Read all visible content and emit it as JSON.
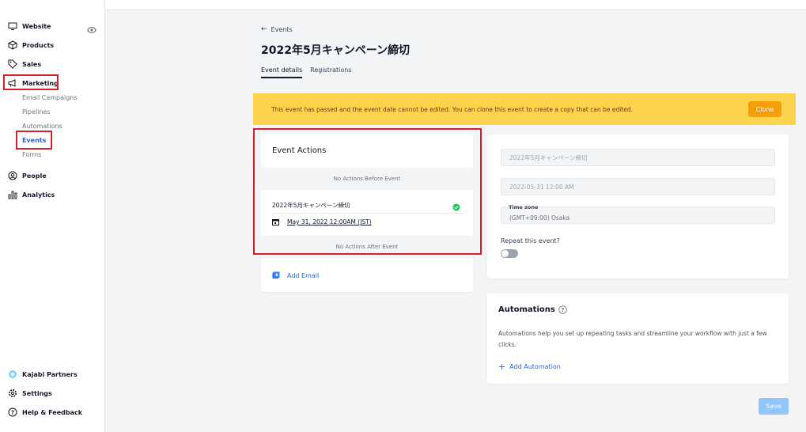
{
  "sidebar": {
    "items": [
      {
        "label": "Website",
        "icon": "monitor-icon"
      },
      {
        "label": "Products",
        "icon": "box-icon"
      },
      {
        "label": "Sales",
        "icon": "tag-icon"
      },
      {
        "label": "Marketing",
        "icon": "megaphone-icon"
      },
      {
        "label": "People",
        "icon": "person-icon"
      },
      {
        "label": "Analytics",
        "icon": "bar-chart-icon"
      }
    ],
    "marketing_sub": [
      "Email Campaigns",
      "Pipelines",
      "Automations",
      "Events",
      "Forms"
    ],
    "bottom": [
      {
        "label": "Kajabi Partners",
        "icon": "partners-icon"
      },
      {
        "label": "Settings",
        "icon": "gear-icon"
      },
      {
        "label": "Help & Feedback",
        "icon": "help-icon"
      }
    ]
  },
  "header": {
    "back_label": "Events",
    "title": "2022年5月キャンペーン締切",
    "tabs": [
      "Event details",
      "Registrations"
    ]
  },
  "banner": {
    "text": "This event has passed and the event date cannot be edited. You can clone this event to create a copy that can be edited.",
    "clone_label": "Clone"
  },
  "event_actions": {
    "title": "Event Actions",
    "before_label": "No Actions Before Event",
    "event_name": "2022年5月キャンペーン締切",
    "event_date": "May 31, 2022 12:00AM (JST)",
    "after_label": "No Actions After Event",
    "add_email_label": "Add Email"
  },
  "details": {
    "name_value": "2022年5月キャンペーン締切",
    "date_value": "2022-05-31 12:00 AM",
    "timezone_label": "Time zone",
    "timezone_value": "(GMT+09:00) Osaka",
    "repeat_label": "Repeat this event?"
  },
  "automations": {
    "title": "Automations",
    "description": "Automations help you set up repeating tasks and streamline your workflow with just a few clicks.",
    "add_label": "Add Automation"
  },
  "save_label": "Save",
  "colors": {
    "accent": "#2563eb",
    "banner": "#fcd34d",
    "clone": "#f59e0b",
    "highlight": "#d32029",
    "success": "#22c55e"
  }
}
